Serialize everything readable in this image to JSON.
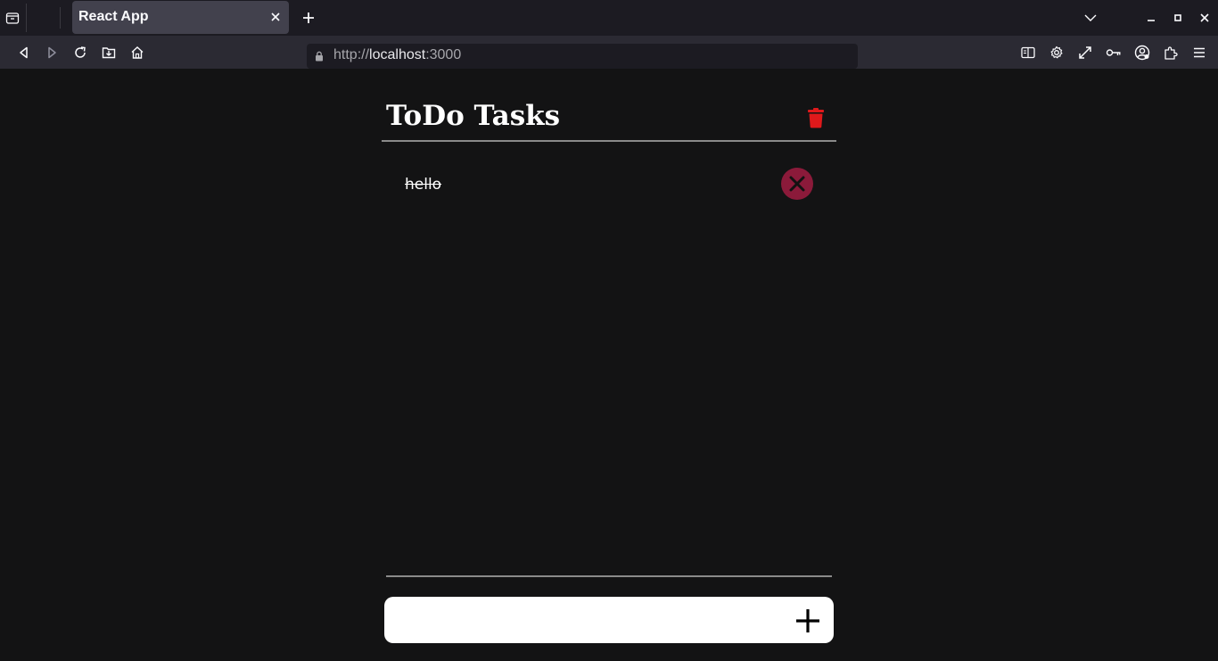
{
  "browser": {
    "tab": {
      "title": "React App"
    },
    "url": {
      "scheme": "http://",
      "host": "localhost",
      "port": ":3000"
    },
    "icons": {
      "tab_list": "tab-list-icon",
      "close": "close-icon",
      "new_tab": "plus-icon",
      "back": "back-arrow-icon",
      "forward": "forward-arrow-icon",
      "reload": "reload-icon",
      "downloads": "folder-download-icon",
      "home": "home-icon",
      "reader": "reader-view-icon",
      "settings": "gear-icon",
      "fullscreen": "expand-icon",
      "passwords": "key-icon",
      "account": "account-icon",
      "extensions": "puzzle-icon",
      "menu": "hamburger-menu-icon"
    }
  },
  "app": {
    "title": "ToDo Tasks",
    "tasks": [
      {
        "text": "hello",
        "completed": true
      }
    ],
    "input": {
      "value": "",
      "placeholder": ""
    },
    "colors": {
      "background": "#131314",
      "trash": "#e0191b",
      "task_delete_bg": "#8b1a3a",
      "task_delete_x": "#121212",
      "divider": "#8a8a8a"
    }
  }
}
